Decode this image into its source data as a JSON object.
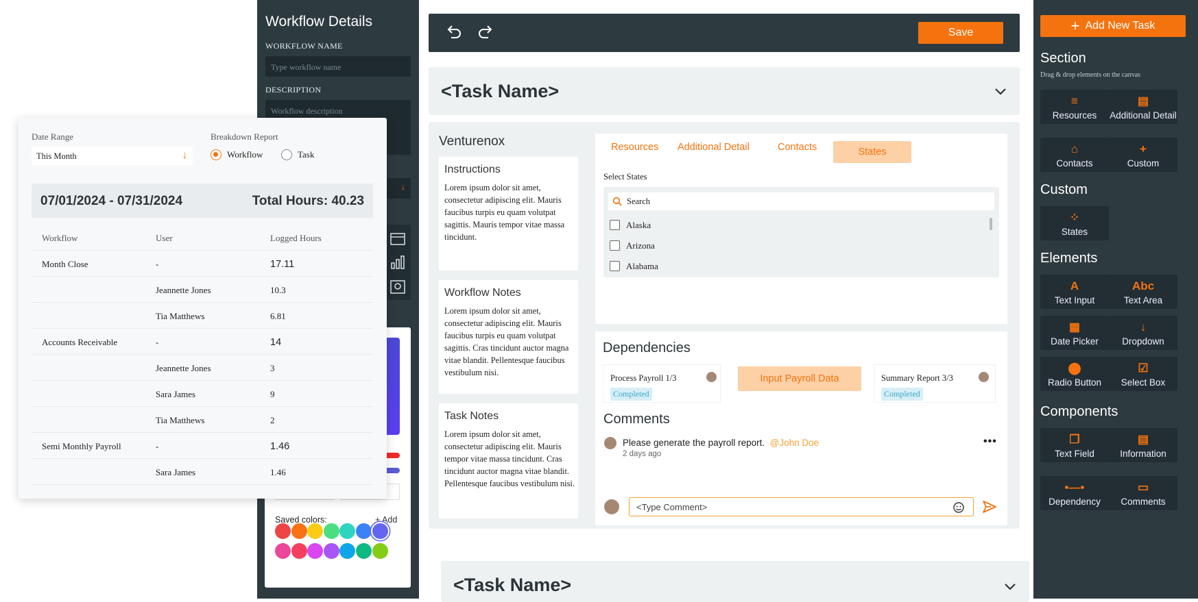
{
  "workflow_panel": {
    "title": "Workflow Details",
    "name_label": "WORKFLOW NAME",
    "name_placeholder": "Type workflow name",
    "desc_label": "DESCRIPTION",
    "desc_placeholder": "Workflow description"
  },
  "color_picker": {
    "saved_label": "Saved colors:",
    "add_label": "+ Add",
    "swatches_row1": [
      "#ef4444",
      "#f97316",
      "#facc15",
      "#4ade80",
      "#2dd4bf",
      "#3b82f6",
      "#6366f1"
    ],
    "swatches_row2": [
      "#ec4899",
      "#f43f5e",
      "#d946ef",
      "#a855f7",
      "#0ea5e9",
      "#10b981",
      "#84cc16"
    ]
  },
  "toolbar": {
    "save_label": "Save",
    "undo_icon": "undo-icon",
    "redo_icon": "redo-icon"
  },
  "task1": {
    "name": "<Task Name>"
  },
  "task2": {
    "name": "<Task Name>"
  },
  "card": {
    "company": "Venturenox",
    "instructions": {
      "title": "Instructions",
      "text": "Lorem ipsum dolor sit amet, consectetur adipiscing elit. Mauris faucibus turpis eu quam volutpat sagittis. Mauris tempor vitae massa tincidunt."
    },
    "workflow_notes": {
      "title": "Workflow Notes",
      "text": "Lorem ipsum dolor sit amet, consectetur adipiscing elit. Mauris faucibus turpis eu quam volutpat sagittis. Cras tincidunt auctor magna vitae blandit. Pellentesque faucibus vestibulum nisi."
    },
    "task_notes": {
      "title": "Task Notes",
      "text": "Lorem ipsum dolor sit amet, consectetur adipiscing elit. Mauris tempor vitae massa tincidunt. Cras tincidunt auctor magna vitae blandit. Pellentesque faucibus vestibulum nisi."
    },
    "tabs": [
      "Resources",
      "Additional Detail",
      "Contacts",
      "States"
    ],
    "active_tab": "States",
    "select_states_label": "Select States",
    "search_placeholder": "Search",
    "states": [
      "Alaska",
      "Arizona",
      "Alabama"
    ],
    "dependencies": {
      "title": "Dependencies",
      "left": {
        "name": "Process Payroll 1/3",
        "status": "Completed"
      },
      "current": "Input Payroll Data",
      "right": {
        "name": "Summary Report 3/3",
        "status": "Completed"
      }
    },
    "comments": {
      "title": "Comments",
      "text": "Please generate the payroll report.",
      "mention": "@John Doe",
      "time": "2 days ago",
      "input_placeholder": "<Type Comment>"
    }
  },
  "right_panel": {
    "add_task": "Add New Task",
    "section_title": "Section",
    "section_hint": "Drag & drop elements on the canvas",
    "section_items": [
      {
        "label": "Resources",
        "icon": "≡"
      },
      {
        "label": "Additional Detail",
        "icon": "▤"
      },
      {
        "label": "Contacts",
        "icon": "⌂"
      },
      {
        "label": "Custom",
        "icon": "+"
      }
    ],
    "custom_title": "Custom",
    "custom_items": [
      {
        "label": "States",
        "icon": "⁘"
      }
    ],
    "elements_title": "Elements",
    "element_items": [
      {
        "label": "Text Input",
        "icon": "A"
      },
      {
        "label": "Text Area",
        "icon": "Abc"
      },
      {
        "label": "Date Picker",
        "icon": "▦"
      },
      {
        "label": "Dropdown",
        "icon": "↓"
      },
      {
        "label": "Radio Button",
        "icon": "⬤"
      },
      {
        "label": "Select Box",
        "icon": "☑"
      }
    ],
    "components_title": "Components",
    "component_items": [
      {
        "label": "Text Field",
        "icon": "❐"
      },
      {
        "label": "Information",
        "icon": "▤"
      },
      {
        "label": "Dependency",
        "icon": "•—•"
      },
      {
        "label": "Comments",
        "icon": "▭"
      }
    ]
  },
  "date_range": {
    "label": "Date Range",
    "value": "This Month",
    "breakdown_label": "Breakdown Report",
    "options": [
      "Workflow",
      "Task"
    ],
    "selected": "Workflow",
    "range_text": "07/01/2024 - 07/31/2024",
    "total_text": "Total Hours: 40.23",
    "columns": [
      "Workflow",
      "User",
      "Logged Hours"
    ],
    "rows": [
      [
        "Month Close",
        "-",
        "17.11"
      ],
      [
        "",
        "Jeannette Jones",
        "10.3"
      ],
      [
        "",
        "Tia Matthews",
        "6.81"
      ],
      [
        "Accounts Receivable",
        "-",
        "14"
      ],
      [
        "",
        "Jeannette Jones",
        "3"
      ],
      [
        "",
        "Sara James",
        "9"
      ],
      [
        "",
        "Tia Matthews",
        "2"
      ],
      [
        "Semi Monthly Payroll",
        "-",
        "1.46"
      ],
      [
        "",
        "Sara James",
        "1.46"
      ]
    ]
  }
}
